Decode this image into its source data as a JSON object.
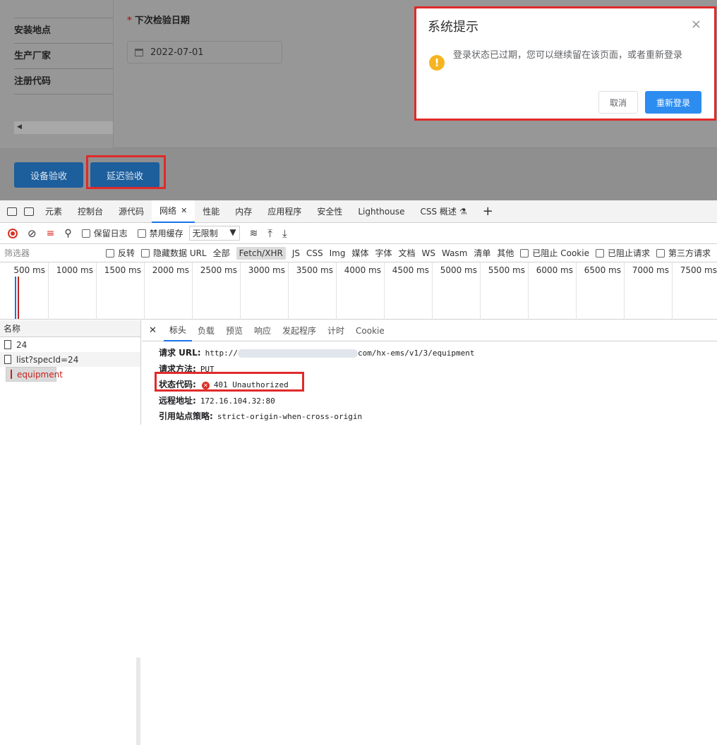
{
  "app": {
    "left_rows": [
      "安装地点",
      "生产厂家",
      "注册代码"
    ],
    "field_label": "下次检验日期",
    "required_star": "*",
    "date_value": "2022-07-01",
    "btn_accept": "设备验收",
    "btn_delay": "延迟验收"
  },
  "dialog": {
    "title": "系统提示",
    "close": "×",
    "message": "登录状态已过期，您可以继续留在该页面，或者重新登录",
    "cancel": "取消",
    "relogin": "重新登录"
  },
  "devtools": {
    "tabs": [
      "元素",
      "控制台",
      "源代码",
      "网络",
      "性能",
      "内存",
      "应用程序",
      "安全性",
      "Lighthouse",
      "CSS 概述"
    ],
    "active_tab": "网络",
    "add_tab": "+",
    "toolbar": {
      "preserve_log": "保留日志",
      "disable_cache": "禁用缓存",
      "throttle": "无限制",
      "throttle_arrow": "▼",
      "upload": "⤒",
      "download": "⤓"
    },
    "filter": {
      "placeholder": "筛选器",
      "invert": "反转",
      "hide_data_urls": "隐藏数据 URL",
      "types": [
        "全部",
        "Fetch/XHR",
        "JS",
        "CSS",
        "Img",
        "媒体",
        "字体",
        "文档",
        "WS",
        "Wasm",
        "清单",
        "其他"
      ],
      "active_type": "Fetch/XHR",
      "blocked_cookies": "已阻止 Cookie",
      "blocked_requests": "已阻止请求",
      "third_party": "第三方请求"
    },
    "timeline_ticks": [
      "500 ms",
      "1000 ms",
      "1500 ms",
      "2000 ms",
      "2500 ms",
      "3000 ms",
      "3500 ms",
      "4000 ms",
      "4500 ms",
      "5000 ms",
      "5500 ms",
      "6000 ms",
      "6500 ms",
      "7000 ms",
      "7500 ms"
    ],
    "name_header": "名称",
    "requests": [
      "24",
      "list?specId=24",
      "equipment"
    ],
    "selected_request": "equipment",
    "detail_tabs": [
      "标头",
      "负载",
      "预览",
      "响应",
      "发起程序",
      "计时",
      "Cookie"
    ],
    "active_detail_tab": "标头",
    "headers": {
      "url_key": "请求 URL:",
      "url_prefix": "http://",
      "url_suffix": "com/hx-ems/v1/3/equipment",
      "method_key": "请求方法:",
      "method_val": "PUT",
      "status_key": "状态代码:",
      "status_val": "401 Unauthorized",
      "remote_key": "远程地址:",
      "remote_val": "172.16.104.32:80",
      "referrer_key": "引用站点策略:",
      "referrer_val": "strict-origin-when-cross-origin"
    }
  },
  "colors": {
    "accent": "#2d8cf0",
    "warning": "#f5b421",
    "error": "#d93025",
    "highlight_box": "#e02a2a"
  }
}
